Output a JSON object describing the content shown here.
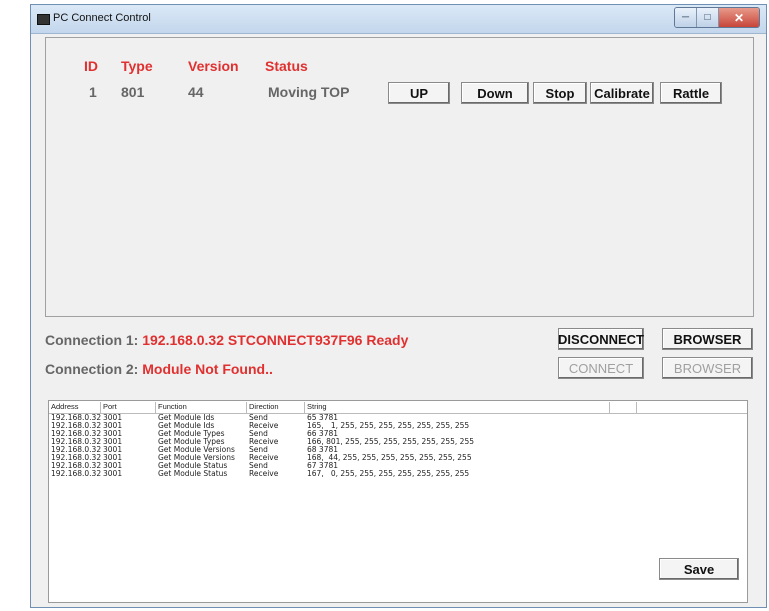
{
  "window": {
    "title": "PC Connect Control"
  },
  "module_table": {
    "headers": {
      "id": "ID",
      "type": "Type",
      "version": "Version",
      "status": "Status"
    },
    "row": {
      "id": "1",
      "type": "801",
      "version": "44",
      "status": "Moving TOP"
    }
  },
  "controls": {
    "up": "UP",
    "down": "Down",
    "stop": "Stop",
    "calibrate": "Calibrate",
    "rattle": "Rattle"
  },
  "connection1": {
    "label": "Connection 1:",
    "value": "192.168.0.32 STCONNECT937F96 Ready",
    "disconnect": "DISCONNECT",
    "browser": "BROWSER"
  },
  "connection2": {
    "label": "Connection 2:",
    "value": "Module Not Found..",
    "connect": "CONNECT",
    "browser": "BROWSER"
  },
  "log": {
    "columns": [
      "Address",
      "Port",
      "Function",
      "Direction",
      "String"
    ],
    "rows": [
      [
        "192.168.0.32",
        "3001",
        "Get Module Ids",
        "Send",
        "65 3781"
      ],
      [
        "192.168.0.32",
        "3001",
        "Get Module Ids",
        "Receive",
        "165,   1, 255, 255, 255, 255, 255, 255, 255"
      ],
      [
        "192.168.0.32",
        "3001",
        "Get Module Types",
        "Send",
        "66 3781"
      ],
      [
        "192.168.0.32",
        "3001",
        "Get Module Types",
        "Receive",
        "166, 801, 255, 255, 255, 255, 255, 255, 255"
      ],
      [
        "192.168.0.32",
        "3001",
        "Get Module Versions",
        "Send",
        "68 3781"
      ],
      [
        "192.168.0.32",
        "3001",
        "Get Module Versions",
        "Receive",
        "168,  44, 255, 255, 255, 255, 255, 255, 255"
      ],
      [
        "192.168.0.32",
        "3001",
        "Get Module Status",
        "Send",
        "67 3781"
      ],
      [
        "192.168.0.32",
        "3001",
        "Get Module Status",
        "Receive",
        "167,   0, 255, 255, 255, 255, 255, 255, 255"
      ]
    ]
  },
  "save_label": "Save"
}
